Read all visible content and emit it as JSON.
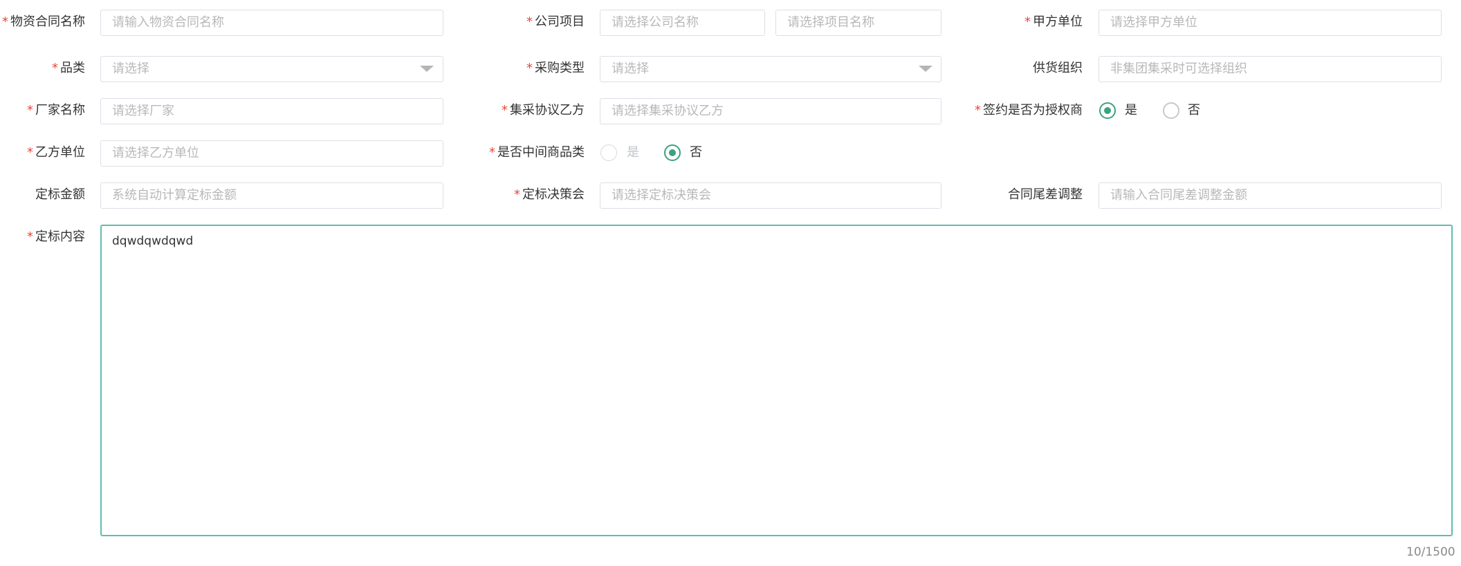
{
  "form": {
    "contract_name": {
      "label": "物资合同名称",
      "placeholder": "请输入物资合同名称"
    },
    "company_project": {
      "label": "公司项目",
      "company_placeholder": "请选择公司名称",
      "project_placeholder": "请选择项目名称"
    },
    "party_a": {
      "label": "甲方单位",
      "placeholder": "请选择甲方单位"
    },
    "category": {
      "label": "品类",
      "placeholder": "请选择"
    },
    "purchase_type": {
      "label": "采购类型",
      "placeholder": "请选择"
    },
    "supply_org": {
      "label": "供货组织",
      "placeholder": "非集团集采时可选择组织"
    },
    "manufacturer": {
      "label": "厂家名称",
      "placeholder": "请选择厂家"
    },
    "central_party_b": {
      "label": "集采协议乙方",
      "placeholder": "请选择集采协议乙方"
    },
    "authorized_dealer": {
      "label": "签约是否为授权商",
      "options": [
        "是",
        "否"
      ],
      "selected": "是"
    },
    "party_b": {
      "label": "乙方单位",
      "placeholder": "请选择乙方单位"
    },
    "intermediary": {
      "label": "是否中间商品类",
      "options": [
        "是",
        "否"
      ],
      "selected": "否"
    },
    "bid_amount": {
      "label": "定标金额",
      "placeholder": "系统自动计算定标金额"
    },
    "bid_committee": {
      "label": "定标决策会",
      "placeholder": "请选择定标决策会"
    },
    "tail_adjust": {
      "label": "合同尾差调整",
      "placeholder": "请输入合同尾差调整金额"
    },
    "bid_content": {
      "label": "定标内容",
      "value": "dqwdqwdqwd",
      "counter": "10/1500"
    }
  },
  "colors": {
    "required": "#e8463b",
    "accent": "#3aa181",
    "focus_border": "#5fbcb0",
    "placeholder": "#b8b8b8"
  },
  "icons": [
    "chevron-down-icon"
  ]
}
